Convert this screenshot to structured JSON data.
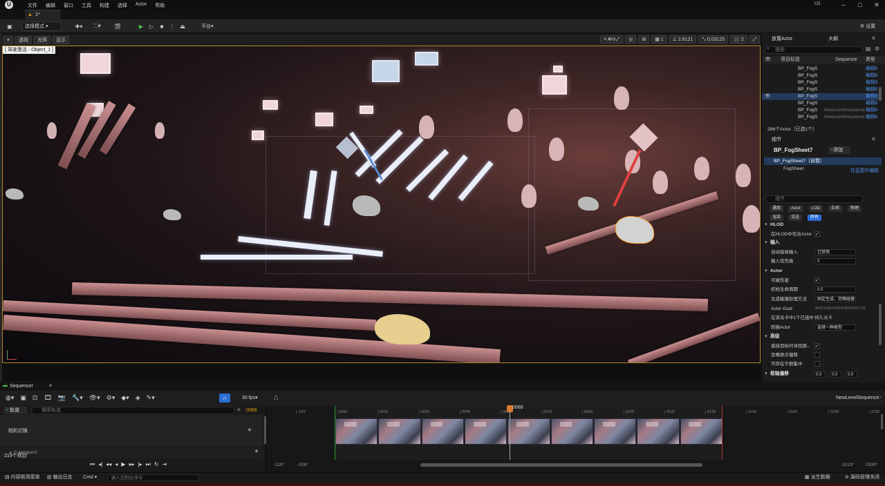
{
  "menu": [
    "文件",
    "编辑",
    "窗口",
    "工具",
    "构建",
    "选择",
    "Actor",
    "帮助"
  ],
  "level_tab": "1*",
  "user_badge": "U1",
  "toolbar": {
    "mode": "选择模式",
    "platform": "平台",
    "settings": "设置"
  },
  "viewport": {
    "top_left": [
      "透视",
      "光照",
      "显示"
    ],
    "pilot_label": "[ 驾驶激活 - Object_1 ]",
    "grid_value": "1",
    "angle_value": "2.8121",
    "scale_value": "0.03125",
    "camera_speed": "2"
  },
  "outliner": {
    "tabs": [
      "放置Actor",
      "大纲"
    ],
    "search_placeholder": "搜索",
    "col_label": "项目标签",
    "col_seq": "Sequence",
    "col_type": "类型",
    "rows": [
      {
        "name": "BP_FogS",
        "mid": "",
        "type": "编辑B"
      },
      {
        "name": "BP_FogS",
        "mid": "",
        "type": "编辑B"
      },
      {
        "name": "BP_FogS",
        "mid": "",
        "type": "编辑B"
      },
      {
        "name": "BP_FogS",
        "mid": "",
        "type": "编辑B"
      },
      {
        "name": "BP_FogS",
        "mid": "",
        "type": "编辑B"
      },
      {
        "name": "BP_FogS",
        "mid": "",
        "type": "编辑B"
      },
      {
        "name": "BP_FogS",
        "mid": "NewLevelSequence",
        "type": "编辑B"
      },
      {
        "name": "BP_FogS",
        "mid": "NewLevelSequence",
        "type": "编辑B"
      }
    ],
    "count": "286个Actor（已选1个）"
  },
  "details": {
    "tab": "细节",
    "actor_name": "BP_FogSheet7",
    "add_label": "添加",
    "self_item": "BP_FogSheet7（自我）",
    "component": "FogSheet",
    "edit_bp": "在蓝图中编辑",
    "search_placeholder": "细节",
    "filters_row1": [
      "通用",
      "Actor",
      "LOD",
      "杂项",
      "物理"
    ],
    "filters_row2": [
      "渲染",
      "流送",
      "所有"
    ],
    "sections": {
      "hlod": "HLOD",
      "input": "输入",
      "actor": "Actor",
      "advanced": "高级",
      "pivot": "枢轴偏移"
    },
    "rows": {
      "hlod_include": "在HLOD中包含Actor",
      "auto_input": "自动接收输入",
      "auto_input_val": "已禁用",
      "input_priority": "输入优先级",
      "input_priority_val": "0",
      "can_damage": "可被伤害",
      "initial_life": "初始生命周期",
      "initial_life_val": "0.0",
      "spawn_collision": "生成碰撞处理方法",
      "spawn_collision_val": "固定生成，忽略碰撞",
      "actor_guid": "Actor Guid",
      "actor_guid_val": "3B6C6AA742D4FBB290FC39",
      "selected_in_editor": "在该关卡中1个已选中",
      "selected_in_editor_val": "持久关卡",
      "convert_actor": "转换Actor",
      "convert_actor_val": "选择一种类型",
      "render_when_selected": "直接目标时寻找随...",
      "ignore_origin": "忽略原点偏移",
      "can_be_in_cluster": "可存在于群集中",
      "pivot_x": "0.0",
      "pivot_y": "0.0",
      "pivot_z": "0.0"
    }
  },
  "sequencer": {
    "tab": "Sequencer",
    "fps": "30 fps",
    "add_track": "轨道",
    "search_placeholder": "搜索轨道",
    "time_box": "0068",
    "camera_track": "相机切换",
    "sub_track": "jiangjian2",
    "item_count": "219个项目",
    "sequence_name": "NewLevelSequence",
    "playhead": "0068",
    "ruler": [
      "-015",
      "0000",
      "0015",
      "0030",
      "0045",
      "0060",
      "0075",
      "0090",
      "0105",
      "0120",
      "0135",
      "0150",
      "0165",
      "0180",
      "0195"
    ],
    "range_start": "-119*",
    "range_start2": "-026*",
    "range_end": "0213*",
    "range_end2": "0330*"
  },
  "statusbar": {
    "content_drawer": "内容侧滑菜单",
    "output_log": "输出日志",
    "cmd": "Cmd",
    "cmd_placeholder": "输入控制台命令",
    "derived_data": "派生数据",
    "source_control": "源码管理关闭"
  }
}
